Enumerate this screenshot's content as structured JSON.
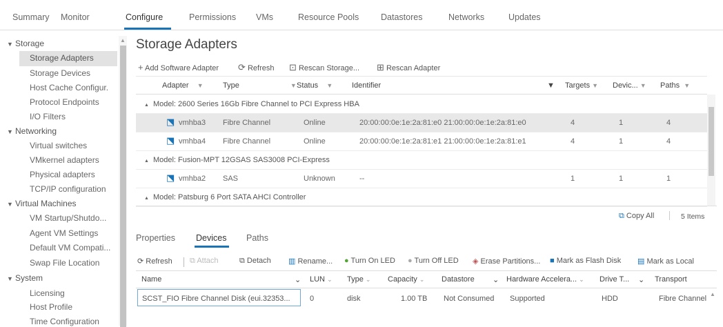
{
  "nav_tabs": [
    "Summary",
    "Monitor",
    "Configure",
    "Permissions",
    "VMs",
    "Resource Pools",
    "Datastores",
    "Networks",
    "Updates"
  ],
  "sidebar": {
    "storage": "Storage",
    "storage_items": [
      "Storage Adapters",
      "Storage Devices",
      "Host Cache Configur.",
      "Protocol Endpoints",
      "I/O Filters"
    ],
    "networking": "Networking",
    "networking_items": [
      "Virtual switches",
      "VMkernel adapters",
      "Physical adapters",
      "TCP/IP configuration"
    ],
    "vm": "Virtual Machines",
    "vm_items": [
      "VM Startup/Shutdo...",
      "Agent VM Settings",
      "Default VM Compati...",
      "Swap File Location"
    ],
    "system": "System",
    "system_items": [
      "Licensing",
      "Host Profile",
      "Time Configuration"
    ]
  },
  "page_title": "Storage Adapters",
  "toolbar": {
    "add": "Add Software Adapter",
    "refresh": "Refresh",
    "rescan_storage": "Rescan Storage...",
    "rescan_adapter": "Rescan Adapter"
  },
  "adapters_table": {
    "headers": [
      "Adapter",
      "Type",
      "Status",
      "Identifier",
      "Targets",
      "Devic...",
      "Paths"
    ],
    "groups": [
      {
        "label": "Model: 2600 Series 16Gb Fibre Channel to PCI Express HBA",
        "rows": [
          [
            "vmhba3",
            "Fibre Channel",
            "Online",
            "20:00:00:0e:1e:2a:81:e0 21:00:00:0e:1e:2a:81:e0",
            "4",
            "1",
            "4"
          ],
          [
            "vmhba4",
            "Fibre Channel",
            "Online",
            "20:00:00:0e:1e:2a:81:e1 21:00:00:0e:1e:2a:81:e1",
            "4",
            "1",
            "4"
          ]
        ]
      },
      {
        "label": "Model: Fusion-MPT 12GSAS SAS3008 PCI-Express",
        "rows": [
          [
            "vmhba2",
            "SAS",
            "Unknown",
            "--",
            "1",
            "1",
            "1"
          ]
        ]
      },
      {
        "label": "Model: Patsburg 6 Port SATA AHCI Controller",
        "rows": []
      }
    ],
    "copy_all": "Copy All",
    "item_count": "5 Items"
  },
  "detail_tabs": [
    "Properties",
    "Devices",
    "Paths"
  ],
  "devices_toolbar": [
    "Refresh",
    "Attach",
    "Detach",
    "Rename...",
    "Turn On LED",
    "Turn Off LED",
    "Erase Partitions...",
    "Mark as Flash Disk",
    "Mark as Local"
  ],
  "devices_table": {
    "headers": [
      "Name",
      "LUN",
      "Type",
      "Capacity",
      "Datastore",
      "Hardware Accelera...",
      "Drive T...",
      "Transport"
    ],
    "rows": [
      [
        "SCST_FIO Fibre Channel Disk (eui.32353...",
        "0",
        "disk",
        "1.00 TB",
        "Not Consumed",
        "Supported",
        "HDD",
        "Fibre Channel"
      ]
    ]
  },
  "colors": {
    "accent": "#1a73b5",
    "selection": "#e2e2e2"
  }
}
